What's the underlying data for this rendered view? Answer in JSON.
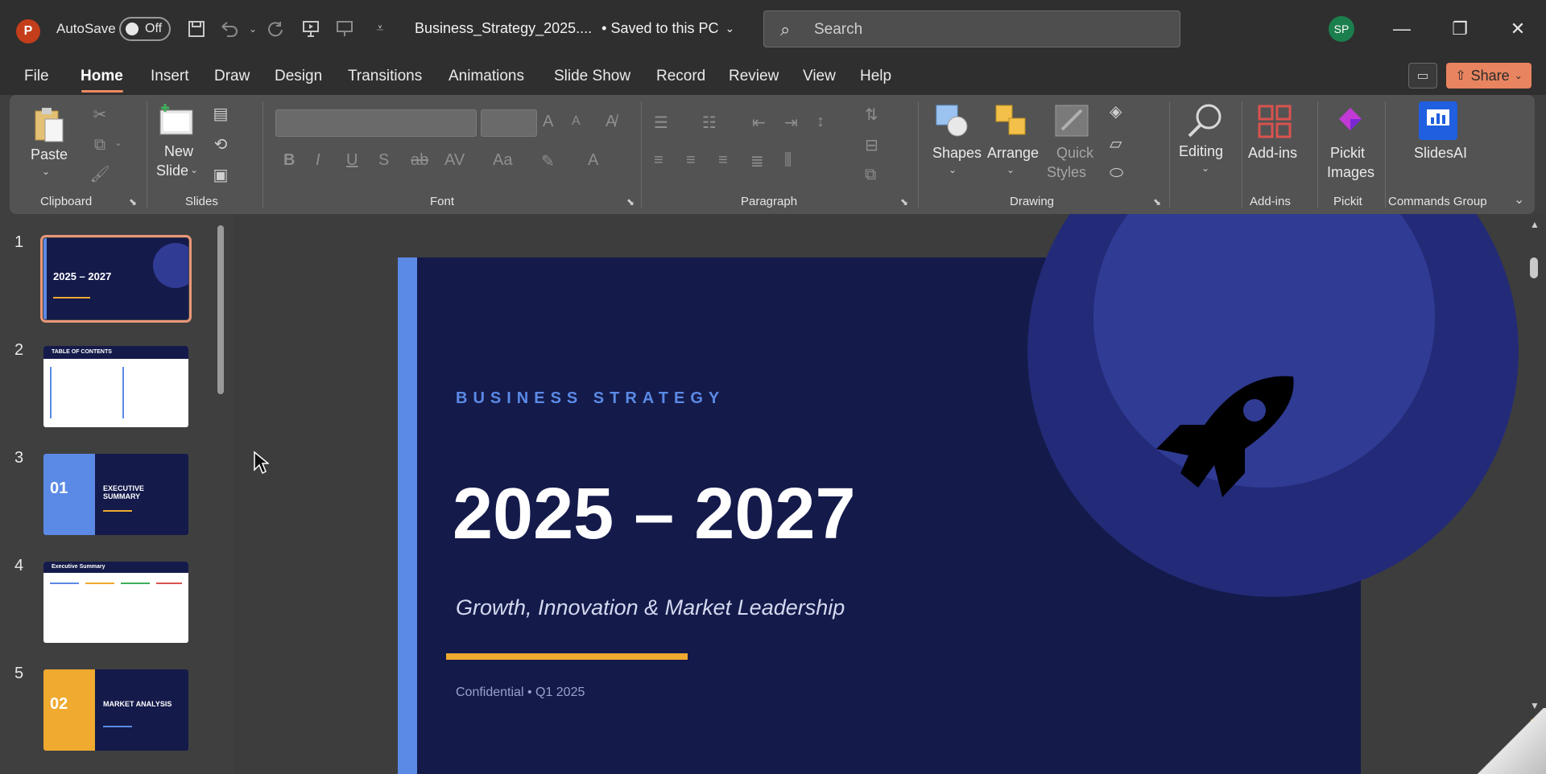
{
  "titlebar": {
    "app_logo": "P",
    "autosave_label": "AutoSave",
    "autosave_state": "Off",
    "doc_title": "Business_Strategy_2025....",
    "save_status": "• Saved to this PC",
    "search_placeholder": "Search",
    "user_initials": "SP"
  },
  "menu": {
    "tabs": [
      "File",
      "Home",
      "Insert",
      "Draw",
      "Design",
      "Transitions",
      "Animations",
      "Slide Show",
      "Record",
      "Review",
      "View",
      "Help"
    ],
    "active_tab": "Home",
    "share_label": "Share"
  },
  "ribbon": {
    "groups": {
      "clipboard": "Clipboard",
      "slides": "Slides",
      "font": "Font",
      "paragraph": "Paragraph",
      "drawing": "Drawing",
      "addins": "Add-ins",
      "pickit": "Pickit",
      "commands": "Commands Group"
    },
    "buttons": {
      "paste": "Paste",
      "new_slide_1": "New",
      "new_slide_2": "Slide",
      "shapes": "Shapes",
      "arrange": "Arrange",
      "quick_styles_1": "Quick",
      "quick_styles_2": "Styles",
      "editing": "Editing",
      "addins": "Add-ins",
      "pickit_1": "Pickit",
      "pickit_2": "Images",
      "slidesai": "SlidesAI"
    }
  },
  "thumbnails": [
    {
      "num": "1",
      "title": "2025 – 2027"
    },
    {
      "num": "2",
      "title": "TABLE OF CONTENTS"
    },
    {
      "num": "3",
      "title": "01",
      "subtitle": "EXECUTIVE SUMMARY"
    },
    {
      "num": "4",
      "title": "Executive Summary"
    },
    {
      "num": "5",
      "title": "02",
      "subtitle": "MARKET ANALYSIS"
    }
  ],
  "slide": {
    "kicker": "BUSINESS STRATEGY",
    "headline": "2025 – 2027",
    "subtitle": "Growth, Innovation & Market Leadership",
    "footer": "Confidential  •  Q1 2025"
  },
  "colors": {
    "slide_bg": "#141a4a",
    "accent_blue": "#5b8ae6",
    "accent_gold": "#efaa2f",
    "share_button": "#e8845f"
  }
}
